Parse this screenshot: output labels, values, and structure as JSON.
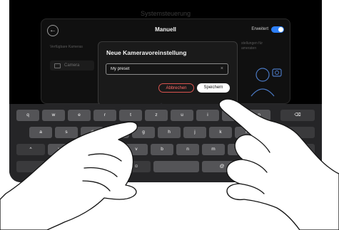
{
  "background_title": "Systemsteuerung",
  "screen": {
    "title": "Manuell",
    "advanced_label": "Erweitert",
    "advanced_on": true,
    "left_heading": "Verfügbare Kameras",
    "right_heading_line1": "stellungen für",
    "right_heading_line2": "ameraten",
    "camera_item": "Camera"
  },
  "dialog": {
    "title": "Neue Kameravoreinstellung",
    "input_value": "My preset",
    "clear_icon": "×",
    "cancel_label": "Abbrechen",
    "save_label": "Speichern"
  },
  "keyboard": {
    "row1": [
      "q",
      "w",
      "e",
      "r",
      "t",
      "z",
      "u",
      "i",
      "o",
      "p"
    ],
    "row2": [
      "a",
      "s",
      "d",
      "f",
      "g",
      "h",
      "j",
      "k",
      "l"
    ],
    "row3": [
      "y",
      "x",
      "c",
      "v",
      "b",
      "n",
      "m",
      ",",
      "."
    ],
    "row4": [
      "123",
      "☺",
      "",
      "@"
    ],
    "backspace_icon": "⌫",
    "shift_icon": "^",
    "accent_color": "#2d7ff9",
    "danger_color": "#ff6a66"
  }
}
